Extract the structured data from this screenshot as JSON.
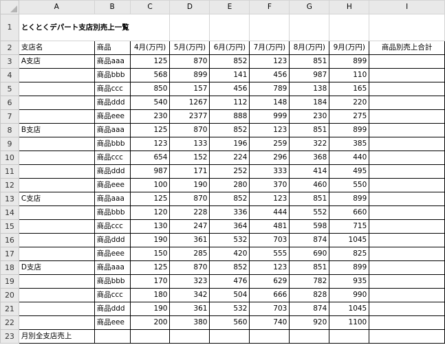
{
  "columns": [
    "A",
    "B",
    "C",
    "D",
    "E",
    "F",
    "G",
    "H",
    "I"
  ],
  "title": "とくとくデパート支店別売上一覧",
  "header": {
    "branch": "支店名",
    "product": "商品",
    "months": [
      "4月(万円)",
      "5月(万円)",
      "6月(万円)",
      "7月(万円)",
      "8月(万円)",
      "9月(万円)"
    ],
    "total": "商品別売上合計"
  },
  "rows": [
    {
      "num": "3",
      "branch": "A支店",
      "product": "商品aaa",
      "values": [
        "125",
        "870",
        "852",
        "123",
        "851",
        "899"
      ]
    },
    {
      "num": "4",
      "branch": "",
      "product": "商品bbb",
      "values": [
        "568",
        "899",
        "141",
        "456",
        "987",
        "110"
      ]
    },
    {
      "num": "5",
      "branch": "",
      "product": "商品ccc",
      "values": [
        "850",
        "157",
        "456",
        "789",
        "138",
        "165"
      ]
    },
    {
      "num": "6",
      "branch": "",
      "product": "商品ddd",
      "values": [
        "540",
        "1267",
        "112",
        "148",
        "184",
        "220"
      ]
    },
    {
      "num": "7",
      "branch": "",
      "product": "商品eee",
      "values": [
        "230",
        "2377",
        "888",
        "999",
        "230",
        "275"
      ]
    },
    {
      "num": "8",
      "branch": "B支店",
      "product": "商品aaa",
      "values": [
        "125",
        "870",
        "852",
        "123",
        "851",
        "899"
      ]
    },
    {
      "num": "9",
      "branch": "",
      "product": "商品bbb",
      "values": [
        "123",
        "133",
        "196",
        "259",
        "322",
        "385"
      ]
    },
    {
      "num": "10",
      "branch": "",
      "product": "商品ccc",
      "values": [
        "654",
        "152",
        "224",
        "296",
        "368",
        "440"
      ]
    },
    {
      "num": "11",
      "branch": "",
      "product": "商品ddd",
      "values": [
        "987",
        "171",
        "252",
        "333",
        "414",
        "495"
      ]
    },
    {
      "num": "12",
      "branch": "",
      "product": "商品eee",
      "values": [
        "100",
        "190",
        "280",
        "370",
        "460",
        "550"
      ]
    },
    {
      "num": "13",
      "branch": "C支店",
      "product": "商品aaa",
      "values": [
        "125",
        "870",
        "852",
        "123",
        "851",
        "899"
      ]
    },
    {
      "num": "14",
      "branch": "",
      "product": "商品bbb",
      "values": [
        "120",
        "228",
        "336",
        "444",
        "552",
        "660"
      ]
    },
    {
      "num": "15",
      "branch": "",
      "product": "商品ccc",
      "values": [
        "130",
        "247",
        "364",
        "481",
        "598",
        "715"
      ]
    },
    {
      "num": "16",
      "branch": "",
      "product": "商品ddd",
      "values": [
        "190",
        "361",
        "532",
        "703",
        "874",
        "1045"
      ]
    },
    {
      "num": "17",
      "branch": "",
      "product": "商品eee",
      "values": [
        "150",
        "285",
        "420",
        "555",
        "690",
        "825"
      ]
    },
    {
      "num": "18",
      "branch": "D支店",
      "product": "商品aaa",
      "values": [
        "125",
        "870",
        "852",
        "123",
        "851",
        "899"
      ]
    },
    {
      "num": "19",
      "branch": "",
      "product": "商品bbb",
      "values": [
        "170",
        "323",
        "476",
        "629",
        "782",
        "935"
      ]
    },
    {
      "num": "20",
      "branch": "",
      "product": "商品ccc",
      "values": [
        "180",
        "342",
        "504",
        "666",
        "828",
        "990"
      ]
    },
    {
      "num": "21",
      "branch": "",
      "product": "商品ddd",
      "values": [
        "190",
        "361",
        "532",
        "703",
        "874",
        "1045"
      ]
    },
    {
      "num": "22",
      "branch": "",
      "product": "商品eee",
      "values": [
        "200",
        "380",
        "560",
        "740",
        "920",
        "1100"
      ]
    }
  ],
  "footer": {
    "label": "月別全支店売上"
  },
  "row_numbers": {
    "title": "1",
    "header": "2",
    "footer": "23"
  }
}
